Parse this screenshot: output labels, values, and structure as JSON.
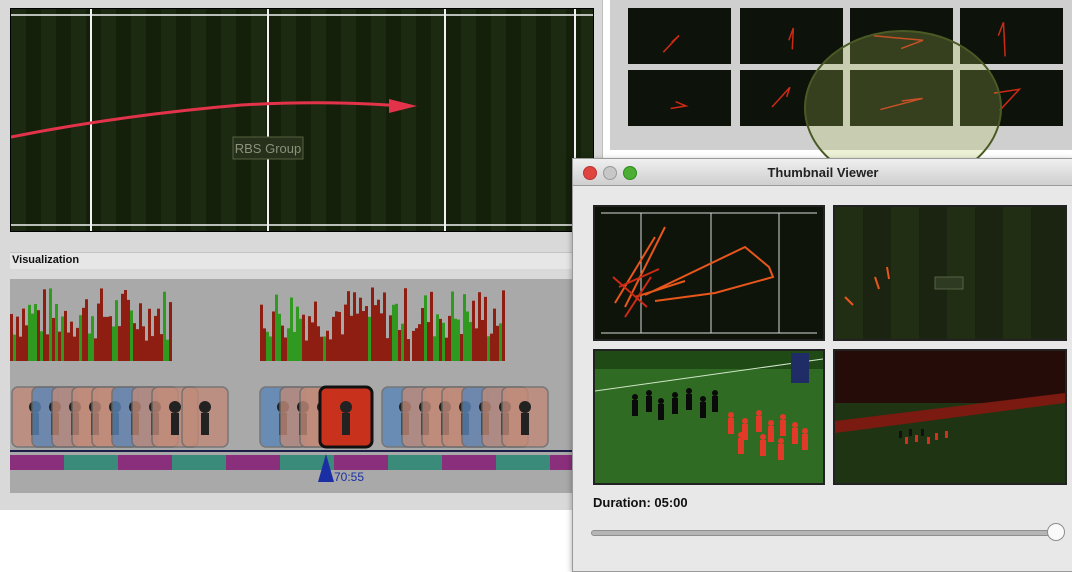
{
  "main": {
    "field_logo": "RBS Group",
    "viz_label": "Visualization",
    "playhead_time": "70:55"
  },
  "thumbnail_viewer": {
    "title": "Thumbnail Viewer",
    "duration_label": "Duration: 05:00",
    "slider_value": 1.0,
    "thumbs": [
      {
        "kind": "trajectory"
      },
      {
        "kind": "field-scatter"
      },
      {
        "kind": "players-photo"
      },
      {
        "kind": "stadium-photo"
      }
    ]
  },
  "colors": {
    "trajectory": "#e2334b",
    "heat_red": "#8e1d12",
    "heat_green": "#2f9a1f",
    "team_teal": "#3a8b7a",
    "team_purple": "#8a2f7c",
    "playhead": "#1a2fa3"
  }
}
